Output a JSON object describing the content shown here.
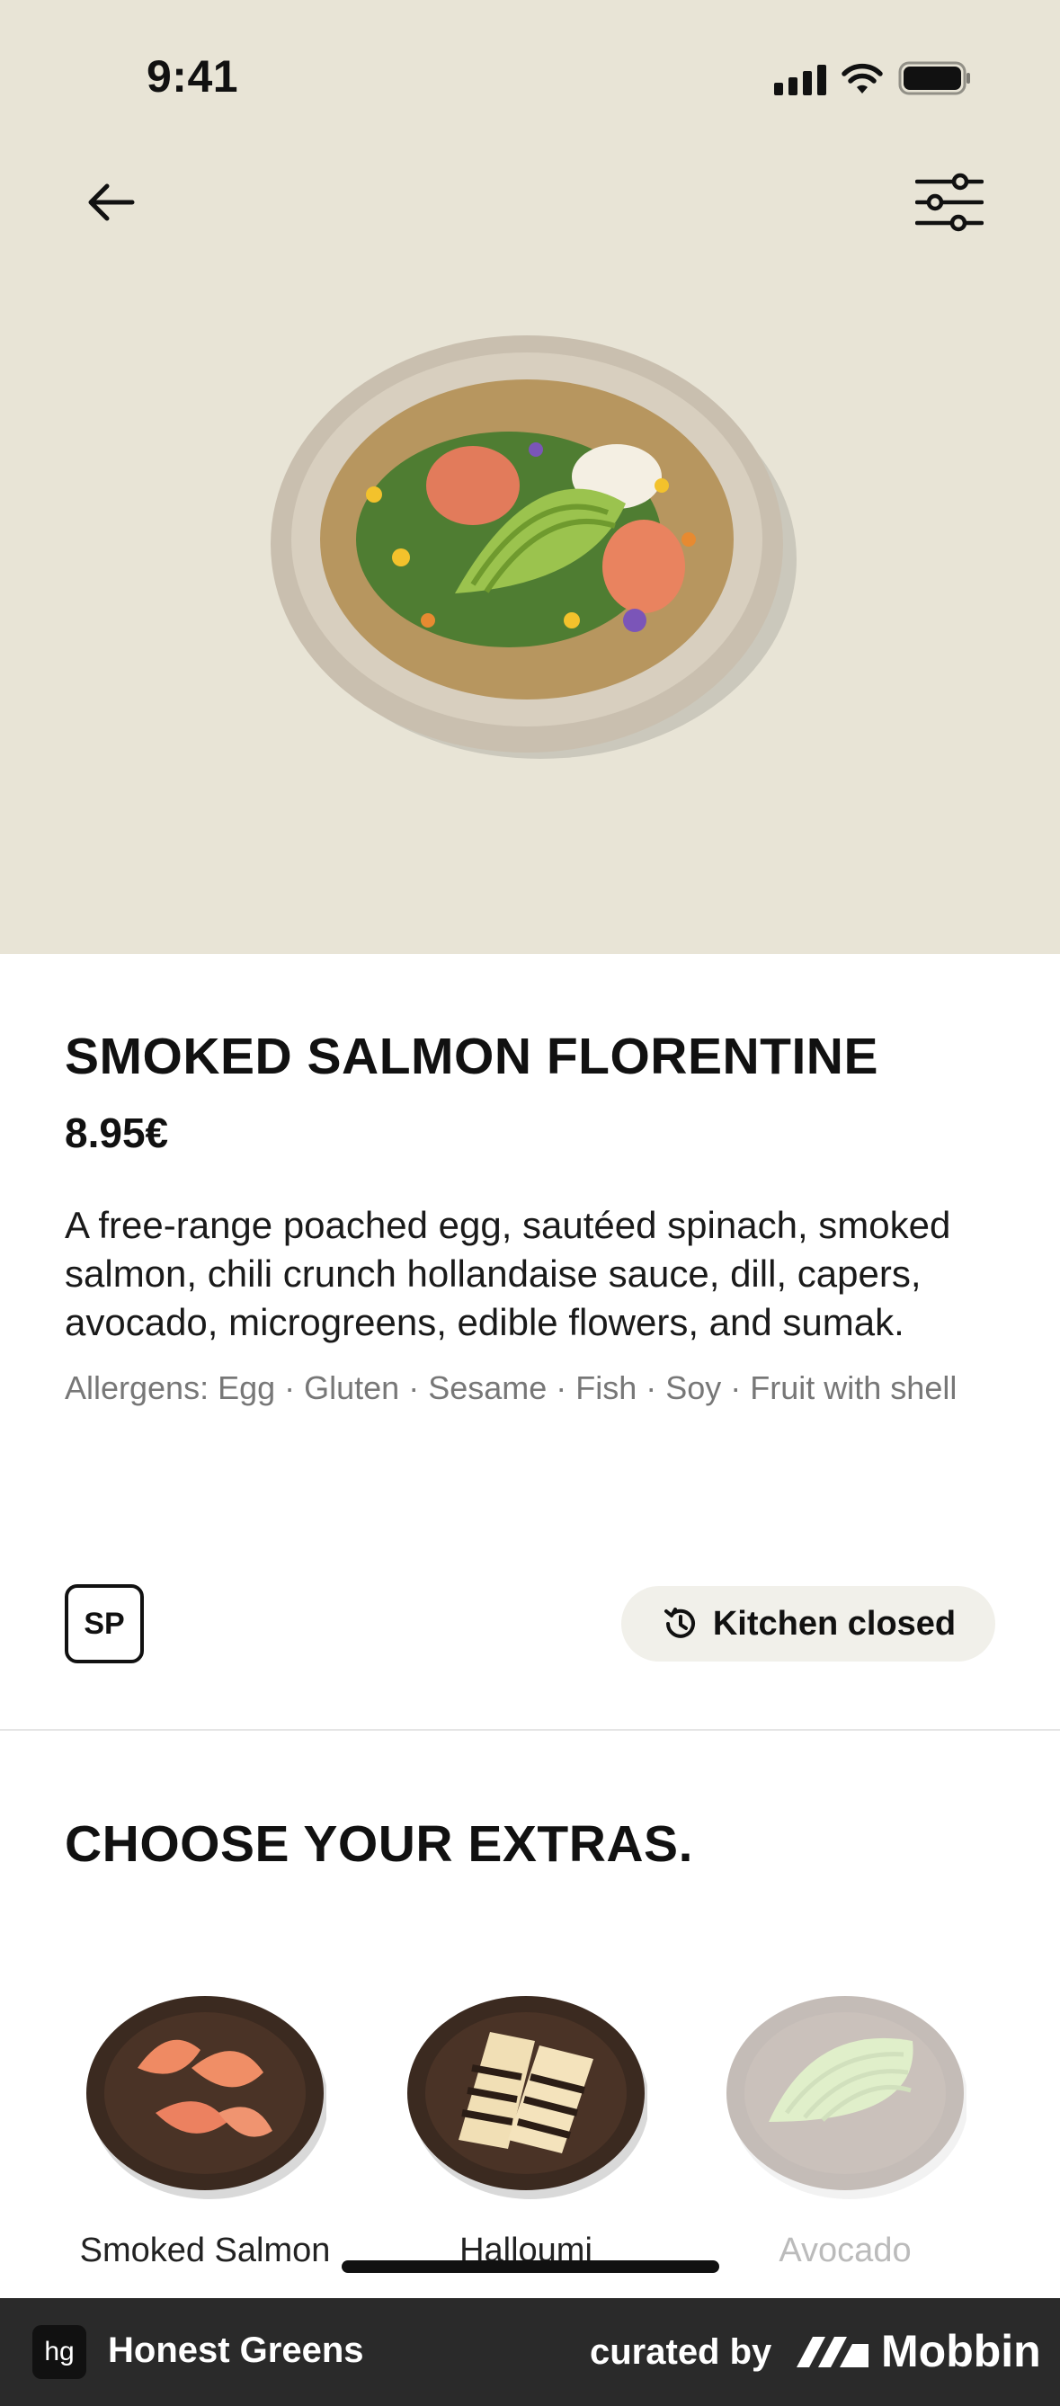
{
  "status_bar": {
    "time": "9:41"
  },
  "product": {
    "title": "SMOKED SALMON FLORENTINE",
    "price": "8.95€",
    "description": "A free-range poached egg, sautéed spinach, smoked salmon, chili crunch hollandaise sauce, dill, capers, avocado, microgreens, edible flowers, and sumak.",
    "allergens": "Allergens: Egg · Gluten · Sesame · Fish · Soy · Fruit with shell",
    "badge": "SP",
    "kitchen_status": "Kitchen closed"
  },
  "extras": {
    "title": "CHOOSE YOUR EXTRAS.",
    "items": [
      {
        "label": "Smoked Salmon",
        "available": true
      },
      {
        "label": "Halloumi",
        "available": true
      },
      {
        "label": "Avocado",
        "available": false
      }
    ]
  },
  "footer": {
    "brand_logo": "hg",
    "brand_name": "Honest Greens",
    "curated_by": "curated by",
    "mobbin": "Mobbin"
  },
  "colors": {
    "hero_bg": "#e8e4d6",
    "footer_bg": "#2a2a2a",
    "pill_bg": "#f1f0ea"
  }
}
